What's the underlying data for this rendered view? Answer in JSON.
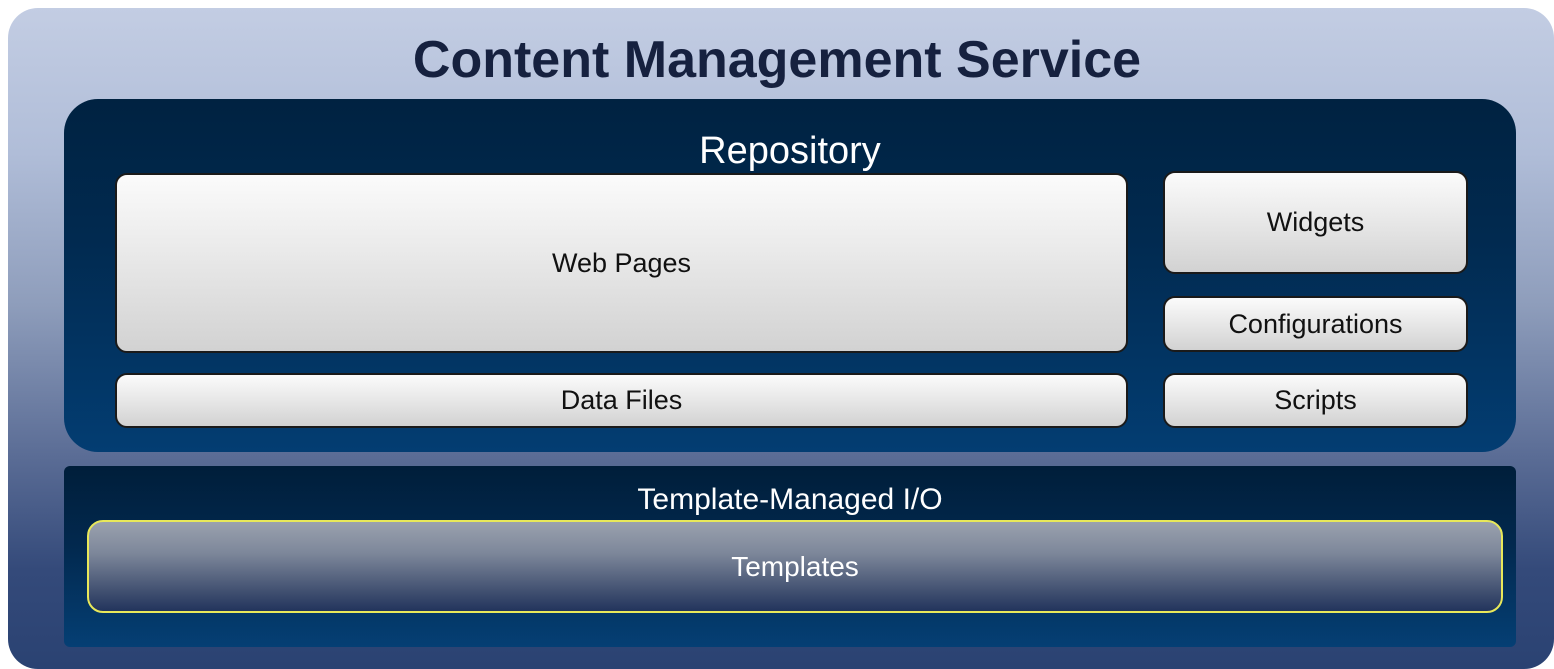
{
  "diagram": {
    "title": "Content Management Service",
    "repository": {
      "title": "Repository",
      "blocks": {
        "web_pages": "Web Pages",
        "data_files": "Data Files",
        "widgets": "Widgets",
        "configurations": "Configurations",
        "scripts": "Scripts"
      }
    },
    "io_layer": {
      "title": "Template-Managed I/O",
      "templates": "Templates"
    }
  }
}
